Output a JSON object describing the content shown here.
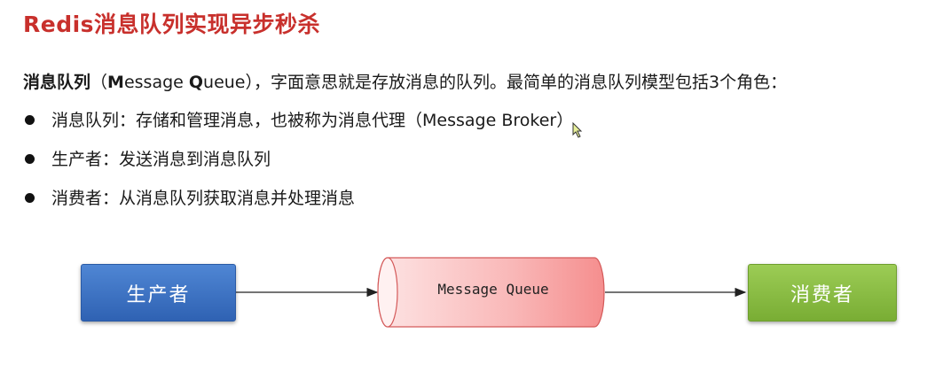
{
  "title": "Redis消息队列实现异步秒杀",
  "intro": {
    "term": "消息队列",
    "paren_open": "（",
    "m_letter": "M",
    "m_rest": "essage ",
    "q_letter": "Q",
    "q_rest": "ueue",
    "paren_close": "），",
    "rest": "字面意思就是存放消息的队列。最简单的消息队列模型包括3个角色："
  },
  "bullets": [
    "消息队列：存储和管理消息，也被称为消息代理（Message Broker）",
    "生产者：发送消息到消息队列",
    "消费者：从消息队列获取消息并处理消息"
  ],
  "diagram": {
    "producer_label": "生产者",
    "queue_label": "Message Queue",
    "consumer_label": "消费者"
  },
  "colors": {
    "title": "#c8302c",
    "producer": "#3a6fc4",
    "consumer": "#86bb40",
    "queue": "#f7a8a8"
  }
}
